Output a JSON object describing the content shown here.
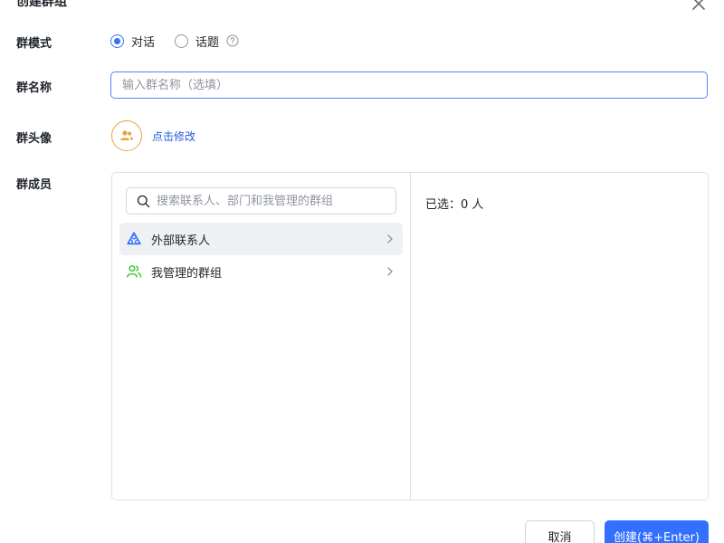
{
  "dialog": {
    "title": "创建群组"
  },
  "group_mode": {
    "label": "群模式",
    "options": [
      {
        "label": "对话",
        "checked": true
      },
      {
        "label": "话题",
        "checked": false
      }
    ]
  },
  "group_name": {
    "label": "群名称",
    "placeholder": "输入群名称（选填）",
    "value": ""
  },
  "group_avatar": {
    "label": "群头像",
    "edit_label": "点击修改"
  },
  "group_members": {
    "label": "群成员",
    "search_placeholder": "搜索联系人、部门和我管理的群组",
    "items": [
      {
        "label": "外部联系人",
        "icon": "external-contacts-icon"
      },
      {
        "label": "我管理的群组",
        "icon": "managed-groups-icon"
      }
    ],
    "selected_text": "已选：0 人"
  },
  "footer": {
    "cancel_label": "取消",
    "create_label": "创建(⌘+Enter)"
  },
  "colors": {
    "accent": "#3370ff",
    "avatar_ring": "#e8a23b",
    "group_icon": "#34c724"
  }
}
